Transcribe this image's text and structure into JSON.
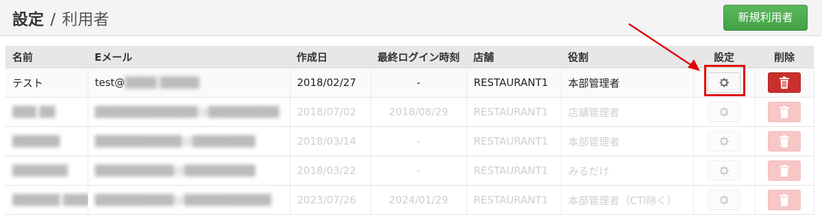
{
  "header": {
    "title_main": "設定",
    "title_sep": "/",
    "title_sub": "利用者",
    "new_user_label": "新規利用者"
  },
  "table": {
    "columns": [
      "名前",
      "Eメール",
      "作成日",
      "最終ログイン時刻",
      "店舗",
      "役割",
      "設定",
      "削除"
    ],
    "rows": [
      {
        "name": "テスト",
        "email": "test@",
        "email_blurred": "████ █████",
        "created": "2018/02/27",
        "last_login": "-",
        "store": "RESTAURANT1",
        "role": "本部管理者"
      },
      {
        "name": "",
        "email": "",
        "created": "2018/07/02",
        "last_login": "2018/08/29",
        "store": "RESTAURANT1",
        "role": "店舗管理者"
      },
      {
        "name": "",
        "email": "",
        "created": "2018/03/14",
        "last_login": "-",
        "store": "RESTAURANT1",
        "role": "本部管理者"
      },
      {
        "name": "",
        "email": "",
        "created": "2018/03/22",
        "last_login": "-",
        "store": "RESTAURANT1",
        "role": "みるだけ"
      },
      {
        "name": "",
        "email": "",
        "created": "2023/07/26",
        "last_login": "2024/01/29",
        "store": "RESTAURANT1",
        "role": "本部管理者（CTI除く）"
      }
    ]
  },
  "icons": {
    "settings": "gear-icon",
    "delete": "trash-icon"
  },
  "colors": {
    "new_button": "#4cae4c",
    "delete_button": "#c9302c",
    "highlight": "#e00000"
  }
}
